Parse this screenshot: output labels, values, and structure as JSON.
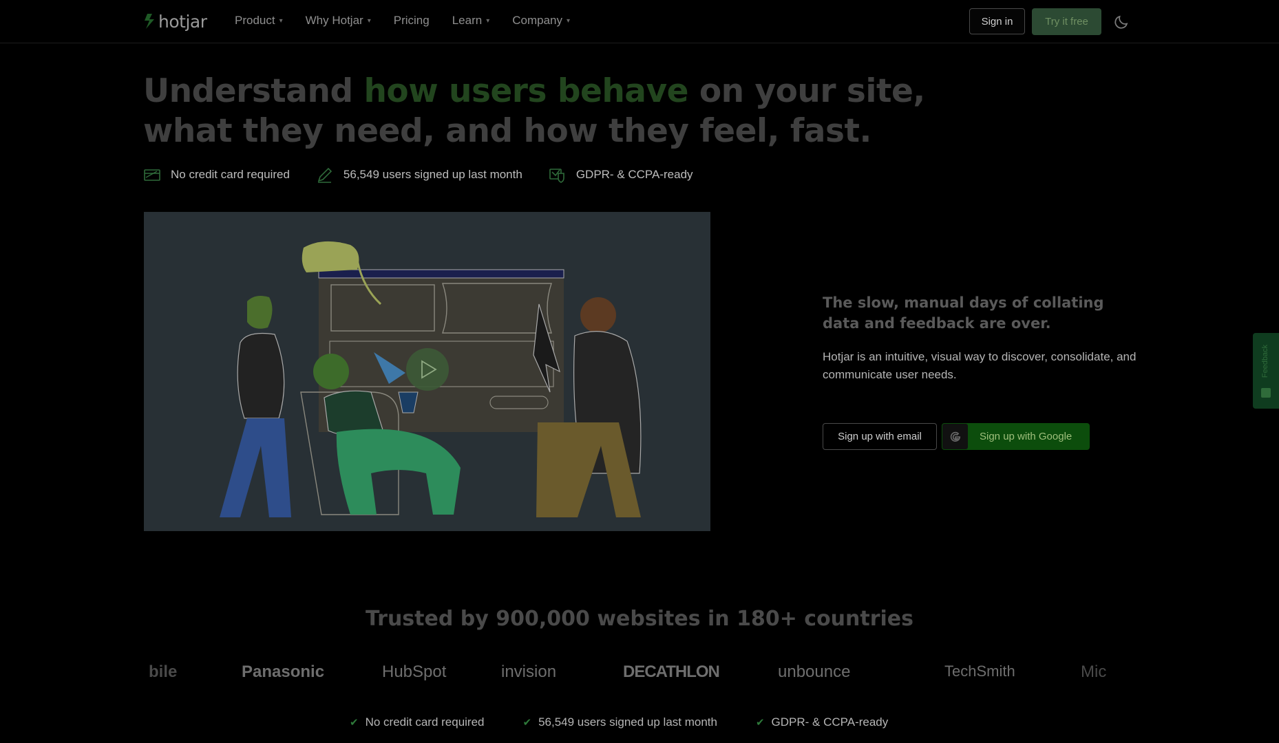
{
  "nav": {
    "logo_text": "hotjar",
    "menu": [
      {
        "label": "Product",
        "has_dropdown": true
      },
      {
        "label": "Why Hotjar",
        "has_dropdown": true
      },
      {
        "label": "Pricing",
        "has_dropdown": false
      },
      {
        "label": "Learn",
        "has_dropdown": true
      },
      {
        "label": "Company",
        "has_dropdown": true
      }
    ],
    "signin_label": "Sign in",
    "try_label": "Try it free",
    "theme_icon": "moon-icon"
  },
  "hero": {
    "title_pre": "Understand ",
    "title_accent": "how users behave",
    "title_post": " on your site, what they need, and how they feel, fast.",
    "badges": [
      {
        "icon": "credit-card-icon",
        "text": "No credit card required"
      },
      {
        "icon": "pencil-icon",
        "text": "56,549 users signed up last month"
      },
      {
        "icon": "shield-check-icon",
        "text": "GDPR- & CCPA-ready"
      }
    ]
  },
  "side": {
    "heading": "The slow, manual days of collating data and feedback are over.",
    "text": "Hotjar is an intuitive, visual way to discover, consolidate, and communicate user needs.",
    "email_button": "Sign up with email",
    "google_button": "Sign up with Google"
  },
  "feedback_tab": {
    "label": "Feedback"
  },
  "trusted": {
    "heading": "Trusted by 900,000 websites in 180+ countries",
    "logos": [
      "bile",
      "Panasonic",
      "HubSpot",
      "invision",
      "DECATHLON",
      "unbounce",
      "TechSmith",
      "Mic"
    ]
  },
  "bottom_badges": [
    "No credit card required",
    "56,549 users signed up last month",
    "GDPR- & CCPA-ready"
  ],
  "colors": {
    "background": "#000000",
    "accent_green": "#22451e",
    "google_button": "#0c4d0c",
    "try_button": "#2c4a33"
  }
}
